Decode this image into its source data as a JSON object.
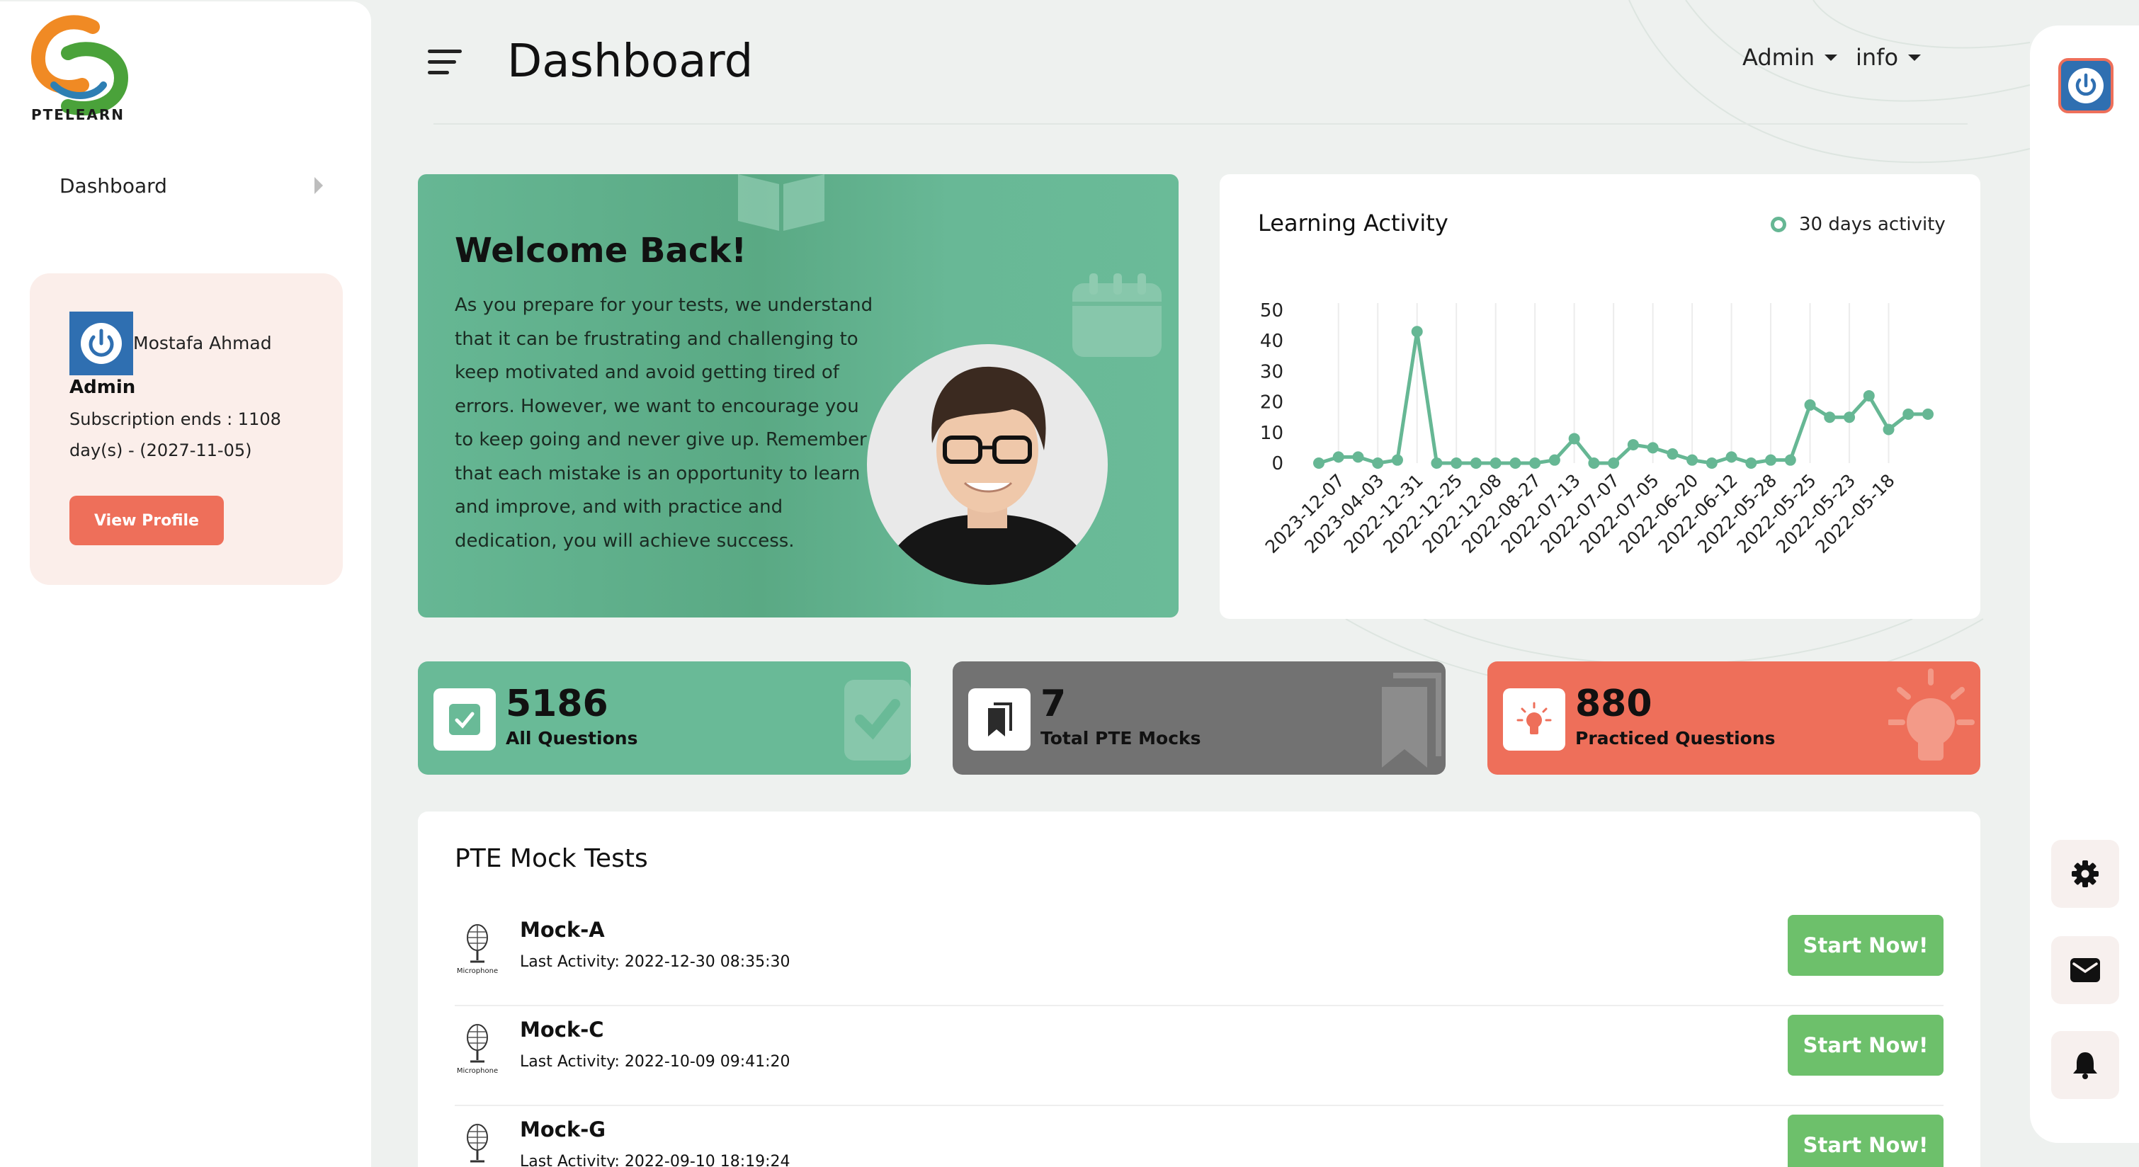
{
  "brand": {
    "logo_text": "PTELEARN"
  },
  "sidebar": {
    "nav": [
      {
        "label": "Dashboard"
      }
    ],
    "profile": {
      "name": "Mostafa Ahmad",
      "role": "Admin",
      "subscription": "Subscription ends : 1108 day(s) - (2027-11-05)",
      "button": "View Profile"
    }
  },
  "header": {
    "title": "Dashboard",
    "menus": [
      {
        "label": "Admin"
      },
      {
        "label": "info"
      }
    ]
  },
  "welcome": {
    "title": "Welcome Back!",
    "body": "As you prepare for your tests, we understand that it can be frustrating and challenging to keep motivated and avoid getting tired of errors. However, we want to encourage you to keep going and never give up. Remember that each mistake is an opportunity to learn and improve, and with practice and dedication, you will achieve success."
  },
  "activity": {
    "title": "Learning Activity",
    "legend": "30 days activity"
  },
  "chart_data": {
    "type": "line",
    "title": "Learning Activity",
    "series": [
      {
        "name": "30 days activity",
        "values": [
          0,
          2,
          2,
          0,
          1,
          43,
          0,
          0,
          0,
          0,
          0,
          0,
          1,
          8,
          0,
          0,
          6,
          5,
          3,
          1,
          0,
          2,
          0,
          1,
          1,
          19,
          15,
          15,
          22,
          11,
          16,
          16
        ]
      }
    ],
    "x_tick_labels": [
      "2023-12-07",
      "2023-04-03",
      "2022-12-31",
      "2022-12-25",
      "2022-12-08",
      "2022-08-27",
      "2022-07-13",
      "2022-07-07",
      "2022-07-05",
      "2022-06-20",
      "2022-06-12",
      "2022-05-28",
      "2022-05-25",
      "2022-05-23",
      "2022-05-18"
    ],
    "y_ticks": [
      0,
      10,
      20,
      30,
      40,
      50
    ],
    "ylim": [
      0,
      50
    ],
    "grid": "vertical",
    "legend_position": "top-right",
    "color": "#66b794"
  },
  "stats": [
    {
      "value": "5186",
      "label": "All Questions",
      "color": "#69ba97",
      "icon": "check-icon"
    },
    {
      "value": "7",
      "label": "Total PTE Mocks",
      "color": "#727272",
      "icon": "bookmark-icon"
    },
    {
      "value": "880",
      "label": "Practiced Questions",
      "color": "#ee6f5a",
      "icon": "lightbulb-icon"
    }
  ],
  "mock_tests": {
    "title": "PTE Mock Tests",
    "thumb_caption": "Microphone",
    "button_label": "Start Now!",
    "items": [
      {
        "name": "Mock-A",
        "last_activity": "Last Activity: 2022-12-30 08:35:30"
      },
      {
        "name": "Mock-C",
        "last_activity": "Last Activity: 2022-10-09 09:41:20"
      },
      {
        "name": "Mock-G",
        "last_activity": "Last Activity: 2022-09-10 18:19:24"
      }
    ]
  }
}
